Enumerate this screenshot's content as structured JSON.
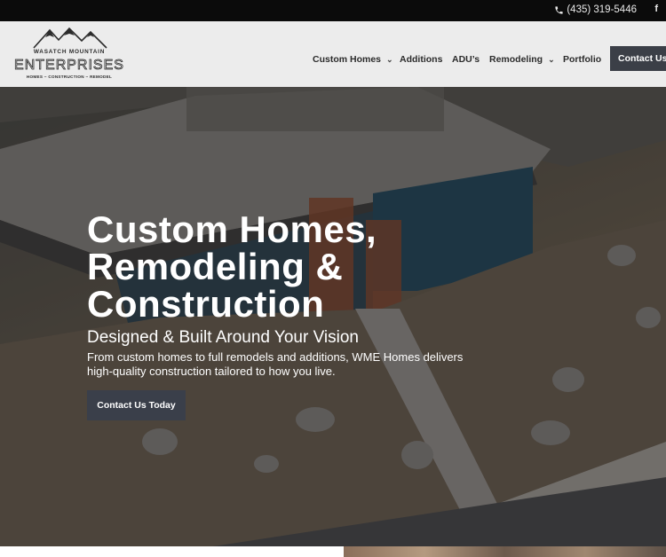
{
  "topbar": {
    "phone": "(435) 319-5446",
    "social_icon": "f"
  },
  "header": {
    "logo": {
      "line1": "WASATCH MOUNTAIN",
      "line2": "ENTERPRISES",
      "line3": "HOMES ~ CONSTRUCTION ~ REMODEL"
    },
    "nav": [
      {
        "label": "Custom Homes",
        "dropdown": true
      },
      {
        "label": "Additions",
        "dropdown": false
      },
      {
        "label": "ADU’s",
        "dropdown": false
      },
      {
        "label": "Remodeling",
        "dropdown": true
      },
      {
        "label": "Portfolio",
        "dropdown": false
      }
    ],
    "contact_label": "Contact Us"
  },
  "hero": {
    "title_lines": [
      "Custom Homes,",
      "Remodeling &",
      "Construction"
    ],
    "subtitle": "Designed & Built Around Your Vision",
    "description": "From custom homes to full remodels and additions, WME Homes delivers high-quality construction tailored to how you live.",
    "cta_label": "Contact Us Today"
  },
  "colors": {
    "accent_button": "#3b3f47",
    "topbar": "#0b0b0b"
  }
}
